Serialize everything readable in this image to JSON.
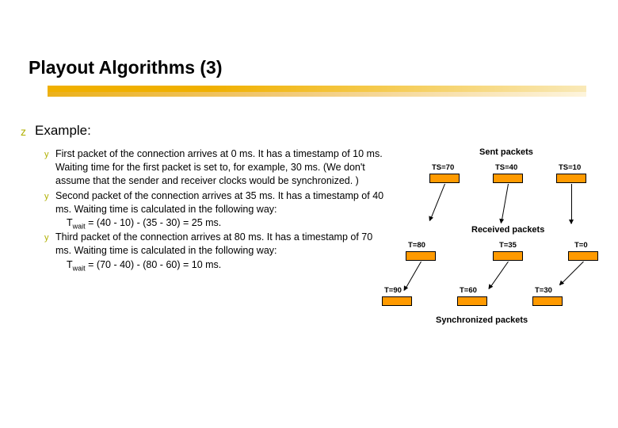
{
  "title": "Playout Algorithms (3)",
  "section": "Example:",
  "items": [
    {
      "text": "First packet of the connection arrives at 0 ms. It has a timestamp of 10 ms. Waiting time for the first packet is set to, for example, 30 ms. (We don't assume that the sender and receiver clocks would be synchronized. )"
    },
    {
      "text": "Second packet of the connection arrives at 35 ms. It has a timestamp of 40 ms. Waiting time is calculated in the following way:",
      "formula": "Twait = (40 - 10) - (35 - 30) = 25 ms."
    },
    {
      "text": "Third packet of the connection arrives at 80 ms. It has a timestamp of 70 ms. Waiting time is calculated in the following way:",
      "formula": "Twait = (70 - 40) - (80 - 60) = 10 ms."
    }
  ],
  "diagram": {
    "rows": [
      {
        "title": "Sent packets",
        "labels": [
          "TS=70",
          "TS=40",
          "TS=10"
        ]
      },
      {
        "title": "Received packets",
        "labels": [
          "T=80",
          "T=35",
          "T=0"
        ]
      },
      {
        "title": "Synchronized packets",
        "labels": [
          "T=90",
          "T=60",
          "T=30"
        ]
      }
    ]
  }
}
